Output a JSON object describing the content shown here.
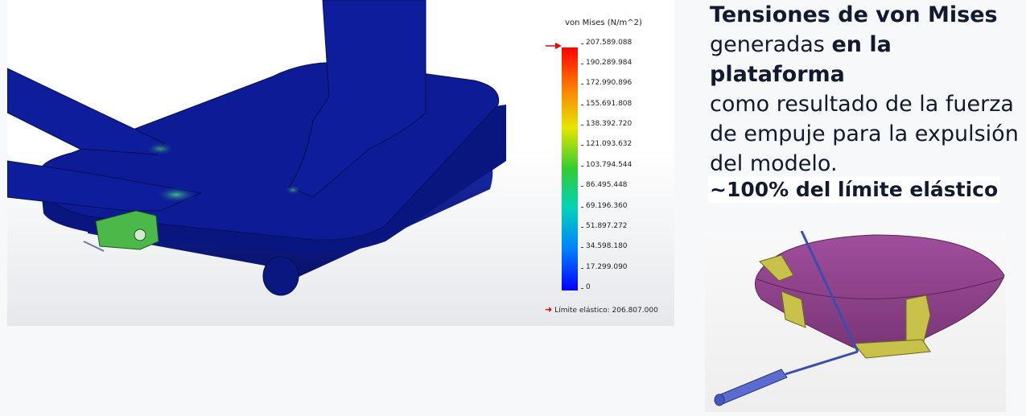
{
  "legend": {
    "title": "von Mises (N/m^2)",
    "ticks": [
      "207.589.088",
      "190.289.984",
      "172.990.896",
      "155.691.808",
      "138.392.720",
      "121.093.632",
      "103.794.544",
      "86.495.448",
      "69.196.360",
      "51.897.272",
      "34.598.180",
      "17.299.090",
      "0"
    ],
    "yield_label": "Límite elástico: 206.807.000",
    "colors": {
      "max": "#ff0000",
      "min": "#0000ff",
      "yield_marker": "#e00000"
    }
  },
  "description": {
    "line1_bold": "Tensiones de von Mises",
    "line2_pre": "generadas ",
    "line2_bold": "en la plataforma",
    "line3": "como resultado de la fuerza",
    "line4": "de empuje para la expulsión",
    "line5": "del modelo."
  },
  "subheading": "~100% del límite elástico",
  "colors": {
    "text": "#111a2e",
    "part_blue": "#0d1a8c",
    "hull": "#8a3f86",
    "bracket": "#c9c24a"
  }
}
